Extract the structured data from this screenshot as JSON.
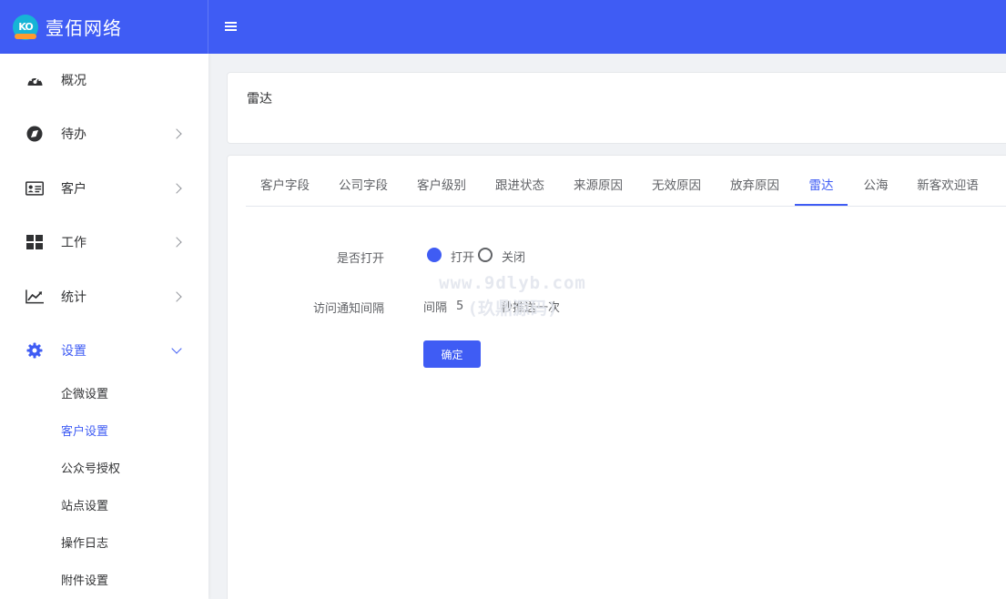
{
  "brand": {
    "name": "壹佰网络",
    "logo_icon": "ko-logo-icon"
  },
  "topbar": {
    "menu_icon": "hamburger-icon"
  },
  "sidebar": {
    "items": [
      {
        "label": "概况",
        "icon": "dashboard-gauge-icon"
      },
      {
        "label": "待办",
        "icon": "compass-icon"
      },
      {
        "label": "客户",
        "icon": "id-card-icon"
      },
      {
        "label": "工作",
        "icon": "grid-icon"
      },
      {
        "label": "统计",
        "icon": "trend-chart-icon"
      },
      {
        "label": "设置",
        "icon": "gear-icon"
      }
    ],
    "sub_items": [
      {
        "label": "企微设置"
      },
      {
        "label": "客户设置"
      },
      {
        "label": "公众号授权"
      },
      {
        "label": "站点设置"
      },
      {
        "label": "操作日志"
      },
      {
        "label": "附件设置"
      }
    ],
    "active_item": "设置",
    "active_sub_item": "客户设置"
  },
  "page": {
    "title": "雷达"
  },
  "tabs": [
    {
      "label": "客户字段"
    },
    {
      "label": "公司字段"
    },
    {
      "label": "客户级别"
    },
    {
      "label": "跟进状态"
    },
    {
      "label": "来源原因"
    },
    {
      "label": "无效原因"
    },
    {
      "label": "放弃原因"
    },
    {
      "label": "雷达"
    },
    {
      "label": "公海"
    },
    {
      "label": "新客欢迎语"
    }
  ],
  "active_tab": "雷达",
  "form": {
    "open_label": "是否打开",
    "open_option": "打开",
    "close_option": "关闭",
    "selected": "打开",
    "interval_label": "访问通知间隔",
    "interval_prefix": "间隔",
    "interval_value": "5",
    "interval_suffix": "秒推送一次",
    "submit_label": "确定"
  },
  "watermark": {
    "line1": "www.9dlyb.com",
    "line2": "(玖鼎源码)"
  },
  "colors": {
    "primary": "#3f5cf4",
    "text": "#303133",
    "muted": "#606266"
  }
}
